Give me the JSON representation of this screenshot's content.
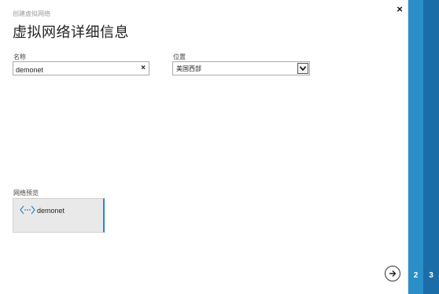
{
  "dialog": {
    "breadcrumb": "创建虚拟网络",
    "title": "虚拟网络详细信息",
    "close_label": "×"
  },
  "form": {
    "name_label": "名称",
    "name_value": "demonet",
    "clear_label": "×",
    "location_label": "位置",
    "location_value": "美国西部"
  },
  "preview": {
    "label": "网络预览",
    "network_name": "demonet",
    "icon": "virtual-network-icon"
  },
  "wizard": {
    "steps": [
      {
        "number": "2"
      },
      {
        "number": "3"
      }
    ]
  },
  "colors": {
    "accent": "#2d86c6",
    "step_active": "#2a8fc9",
    "step_dark": "#1a6da6"
  }
}
